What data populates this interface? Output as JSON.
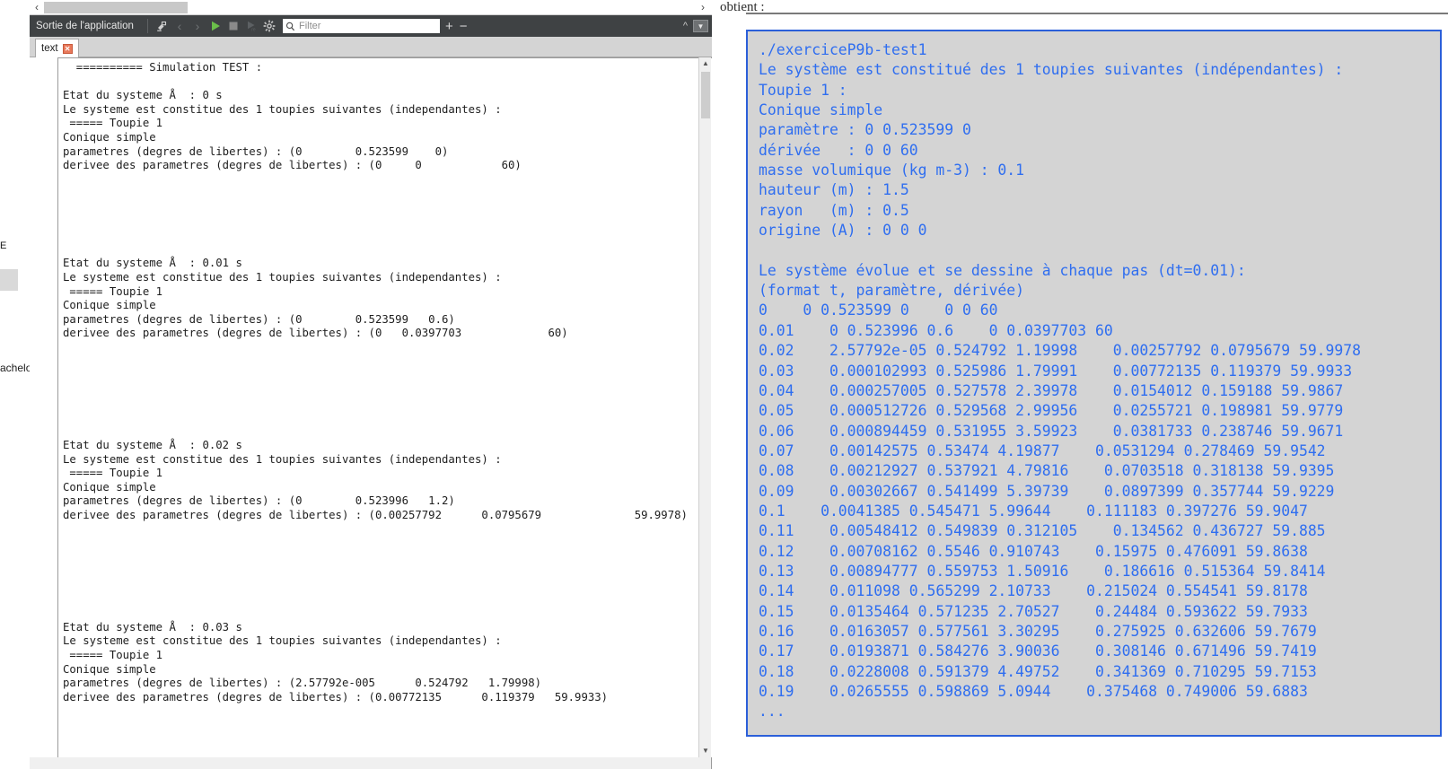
{
  "background_app": {
    "edge_fragment_top": "E",
    "edge_fragment_bottom": "achelo"
  },
  "ide": {
    "splitter": {
      "left_arrow": "‹",
      "right_arrow": "›"
    },
    "toolbar": {
      "title": "Sortie de l'application",
      "icons": [
        {
          "name": "clear-output-icon",
          "label": ""
        },
        {
          "name": "previous-item-icon",
          "label": "‹"
        },
        {
          "name": "next-item-icon",
          "label": "›"
        },
        {
          "name": "run-icon",
          "label": ""
        },
        {
          "name": "stop-icon",
          "label": ""
        },
        {
          "name": "rerun-icon",
          "label": ""
        },
        {
          "name": "settings-gear-icon",
          "label": ""
        }
      ],
      "filter": {
        "placeholder": "Filter",
        "value": ""
      },
      "zoom_in_label": "+",
      "zoom_out_label": "−",
      "collapse_label": "^",
      "dropdown_label": "▼"
    },
    "tabs": [
      {
        "label": "text",
        "close_label": "✕",
        "active": true
      }
    ],
    "scrollbar": {
      "up": "▲",
      "down": "▼"
    },
    "output_text": "  ========== Simulation TEST :\n\nEtat du systeme Å  : 0 s\nLe systeme est constitue des 1 toupies suivantes (independantes) :\n ===== Toupie 1\nConique simple\nparametres (degres de libertes) : (0        0.523599    0)\nderivee des parametres (degres de libertes) : (0     0            60)\n\n\n\n\n\n\nEtat du systeme Å  : 0.01 s\nLe systeme est constitue des 1 toupies suivantes (independantes) :\n ===== Toupie 1\nConique simple\nparametres (degres de libertes) : (0        0.523599   0.6)\nderivee des parametres (degres de libertes) : (0   0.0397703             60)\n\n\n\n\n\n\n\nEtat du systeme Å  : 0.02 s\nLe systeme est constitue des 1 toupies suivantes (independantes) :\n ===== Toupie 1\nConique simple\nparametres (degres de libertes) : (0        0.523996   1.2)\nderivee des parametres (degres de libertes) : (0.00257792      0.0795679              59.9978)\n\n\n\n\n\n\n\nEtat du systeme Å  : 0.03 s\nLe systeme est constitue des 1 toupies suivantes (independantes) :\n ===== Toupie 1\nConique simple\nparametres (degres de libertes) : (2.57792e-005      0.524792   1.79998)\nderivee des parametres (degres de libertes) : (0.00772135      0.119379   59.9933)"
  },
  "document": {
    "preceding_text": "obtient :",
    "code_text": "./exerciceP9b-test1\nLe système est constitué des 1 toupies suivantes (indépendantes) :\nToupie 1 :\nConique simple\nparamètre : 0 0.523599 0\ndérivée   : 0 0 60\nmasse volumique (kg m-3) : 0.1\nhauteur (m) : 1.5\nrayon   (m) : 0.5\norigine (A) : 0 0 0\n\nLe système évolue et se dessine à chaque pas (dt=0.01):\n(format t, paramètre, dérivée)\n0    0 0.523599 0    0 0 60\n0.01    0 0.523996 0.6    0 0.0397703 60\n0.02    2.57792e-05 0.524792 1.19998    0.00257792 0.0795679 59.9978\n0.03    0.000102993 0.525986 1.79991    0.00772135 0.119379 59.9933\n0.04    0.000257005 0.527578 2.39978    0.0154012 0.159188 59.9867\n0.05    0.000512726 0.529568 2.99956    0.0255721 0.198981 59.9779\n0.06    0.000894459 0.531955 3.59923    0.0381733 0.238746 59.9671\n0.07    0.00142575 0.53474 4.19877    0.0531294 0.278469 59.9542\n0.08    0.00212927 0.537921 4.79816    0.0703518 0.318138 59.9395\n0.09    0.00302667 0.541499 5.39739    0.0897399 0.357744 59.9229\n0.1    0.0041385 0.545471 5.99644    0.111183 0.397276 59.9047\n0.11    0.00548412 0.549839 0.312105    0.134562 0.436727 59.885\n0.12    0.00708162 0.5546 0.910743    0.15975 0.476091 59.8638\n0.13    0.00894777 0.559753 1.50916    0.186616 0.515364 59.8414\n0.14    0.011098 0.565299 2.10733    0.215024 0.554541 59.8178\n0.15    0.0135464 0.571235 2.70527    0.24484 0.593622 59.7933\n0.16    0.0163057 0.577561 3.30295    0.275925 0.632606 59.7679\n0.17    0.0193871 0.584276 3.90036    0.308146 0.671496 59.7419\n0.18    0.0228008 0.591379 4.49752    0.341369 0.710295 59.7153\n0.19    0.0265555 0.598869 5.0944    0.375468 0.749006 59.6883\n..."
  },
  "colors": {
    "code_text": "#2f6ef0",
    "code_border": "#2b5fd9",
    "code_background": "#d4d4d4",
    "toolbar_background": "#3f4244",
    "run_icon": "#6bbf4a",
    "stop_icon": "#8a8a8a",
    "tab_close": "#e8785a"
  }
}
